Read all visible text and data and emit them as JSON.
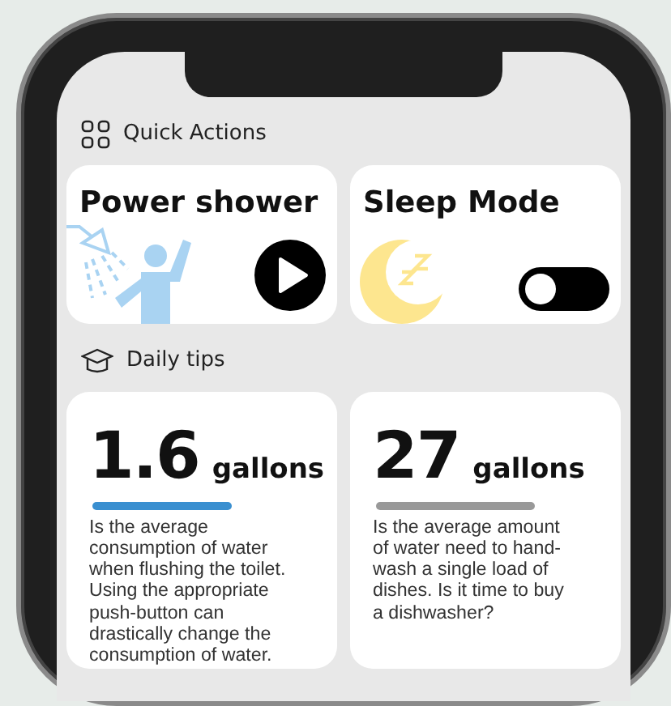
{
  "sections": [
    {
      "kind": "quick_actions",
      "title": "Quick Actions",
      "actions": [
        {
          "kind": "play",
          "title": "Power shower"
        },
        {
          "kind": "toggle",
          "title": "Sleep Mode",
          "on": false
        }
      ]
    },
    {
      "kind": "tips",
      "title": "Daily tips",
      "tips": [
        {
          "value": "1.6",
          "unit": "gallons",
          "color": "#3a8fd0",
          "text": "Is the average consumption of water when flushing the toilet. Using the appropriate push-button can drastically change the consumption of water."
        },
        {
          "value": "27",
          "unit": "gallons",
          "color": "#999999",
          "text": "Is the average amount of water need to hand-wash a single load of dishes. Is it time to buy a dishwasher?"
        }
      ]
    }
  ]
}
